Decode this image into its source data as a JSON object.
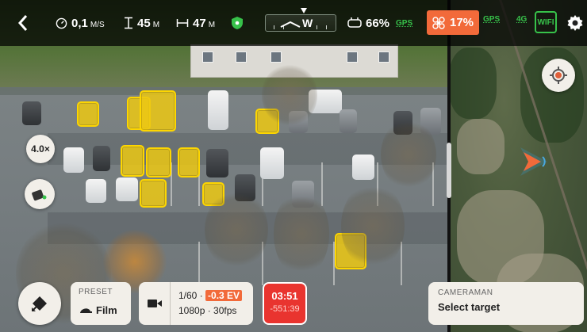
{
  "topbar": {
    "back_icon": "chevron-left-icon",
    "speed": "0,1",
    "speed_unit": "M/S",
    "altitude": "45",
    "altitude_unit": "M",
    "distance": "47",
    "distance_unit": "M",
    "shield_icon": "shield-icon",
    "heading_label": "W",
    "controller_battery": "66%",
    "gps_label": "GPS",
    "drone_battery": "17%",
    "gps2_label": "GPS",
    "network_label": "4G",
    "wifi_label": "WIFI",
    "settings_icon": "gear-icon"
  },
  "camera_view": {
    "zoom_label": "4.0×"
  },
  "bottom": {
    "preset_label": "PRESET",
    "preset_value": "Film",
    "shutter": "1/60 ·",
    "ev": "-0.3 EV",
    "resolution": "1080p · 30fps",
    "rec_time": "03:51",
    "rec_remaining": "-551:39",
    "cameraman_label": "CAMERAMAN",
    "cameraman_value": "Select target"
  },
  "colors": {
    "accent_orange": "#f26a3a",
    "record_red": "#e9342f",
    "gps_green": "#37c24a",
    "highlight_yellow": "#ecc814",
    "panel_bg": "#f2efe9"
  }
}
